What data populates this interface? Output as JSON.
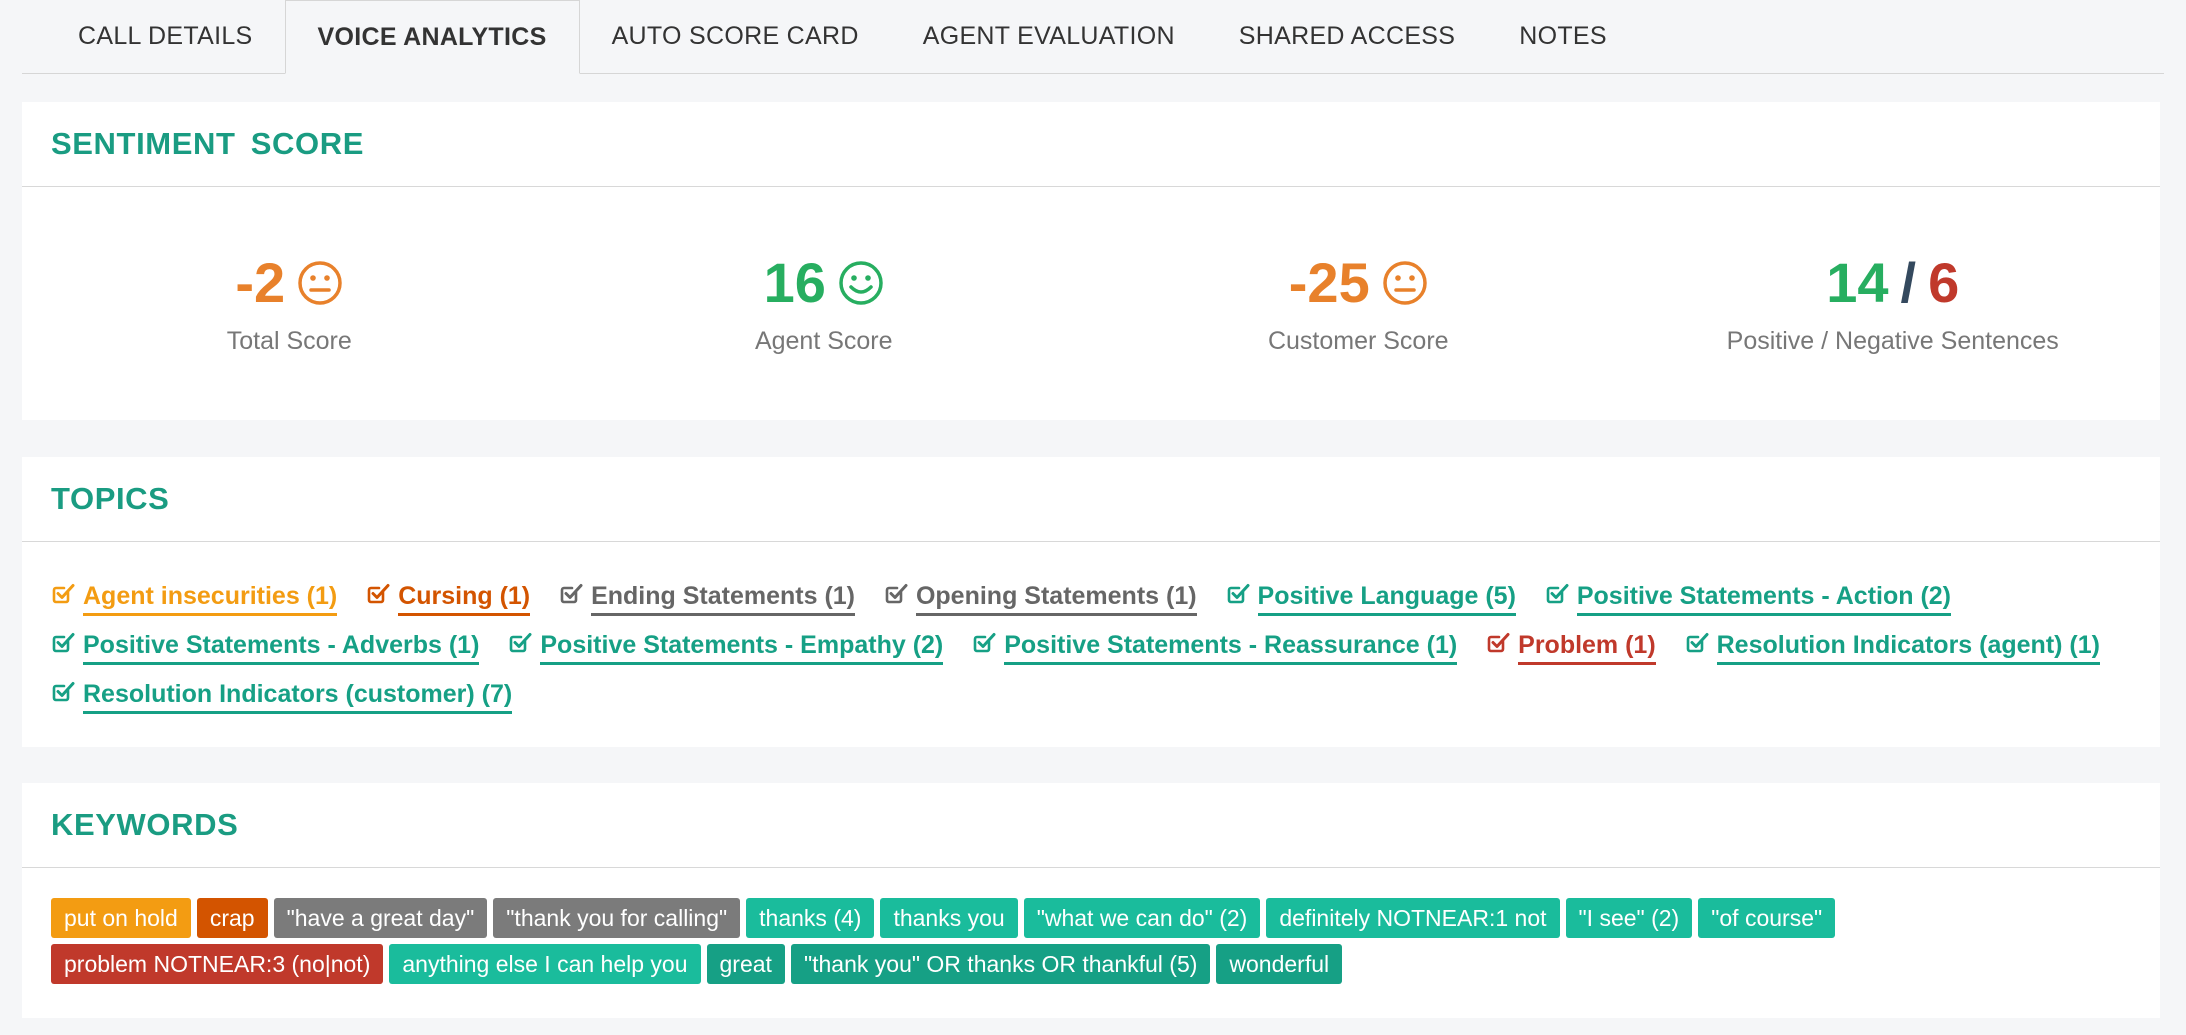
{
  "tabs": [
    "CALL DETAILS",
    "VOICE ANALYTICS",
    "AUTO SCORE CARD",
    "AGENT EVALUATION",
    "SHARED ACCESS",
    "NOTES"
  ],
  "sentiment": {
    "title": "SENTIMENT SCORE",
    "total": {
      "value": "-2",
      "label": "Total Score",
      "face": "neutral-face-icon"
    },
    "agent": {
      "value": "16",
      "label": "Agent Score",
      "face": "smile-face-icon"
    },
    "customer": {
      "value": "-25",
      "label": "Customer Score",
      "face": "neutral-face-icon"
    },
    "sentences": {
      "positive": "14",
      "separator": "/",
      "negative": "6",
      "label": "Positive / Negative Sentences"
    }
  },
  "topics": {
    "title": "TOPICS",
    "items": [
      {
        "label": "Agent insecurities (1)",
        "color": "#f39c12"
      },
      {
        "label": "Cursing (1)",
        "color": "#d35400"
      },
      {
        "label": "Ending Statements (1)",
        "color": "#666666"
      },
      {
        "label": "Opening Statements (1)",
        "color": "#666666"
      },
      {
        "label": "Positive Language (5)",
        "color": "#16a085"
      },
      {
        "label": "Positive Statements - Action (2)",
        "color": "#16a085"
      },
      {
        "label": "Positive Statements - Adverbs (1)",
        "color": "#16a085"
      },
      {
        "label": "Positive Statements - Empathy (2)",
        "color": "#16a085"
      },
      {
        "label": "Positive Statements - Reassurance (1)",
        "color": "#16a085"
      },
      {
        "label": "Problem (1)",
        "color": "#c0392b"
      },
      {
        "label": "Resolution Indicators (agent) (1)",
        "color": "#16a085"
      },
      {
        "label": "Resolution Indicators (customer) (7)",
        "color": "#16a085"
      }
    ]
  },
  "keywords": {
    "title": "KEYWORDS",
    "items": [
      {
        "label": "put on hold",
        "color": "#f39c12"
      },
      {
        "label": "crap",
        "color": "#d35400"
      },
      {
        "label": "\"have a great day\"",
        "color": "#7b7b7b"
      },
      {
        "label": "\"thank you for calling\"",
        "color": "#7b7b7b"
      },
      {
        "label": "thanks (4)",
        "color": "#1abc9c"
      },
      {
        "label": "thanks you",
        "color": "#1abc9c"
      },
      {
        "label": "\"what we can do\" (2)",
        "color": "#1abc9c"
      },
      {
        "label": "definitely NOTNEAR:1 not",
        "color": "#1abc9c"
      },
      {
        "label": "\"I see\" (2)",
        "color": "#1abc9c"
      },
      {
        "label": "\"of course\"",
        "color": "#1abc9c"
      },
      {
        "label": "problem NOTNEAR:3 (no|not)",
        "color": "#c0392b"
      },
      {
        "label": "anything else I can help you",
        "color": "#1abc9c"
      },
      {
        "label": "great",
        "color": "#16a085"
      },
      {
        "label": "\"thank you\" OR thanks OR thankful (5)",
        "color": "#16a085"
      },
      {
        "label": "wonderful",
        "color": "#16a085"
      }
    ]
  }
}
